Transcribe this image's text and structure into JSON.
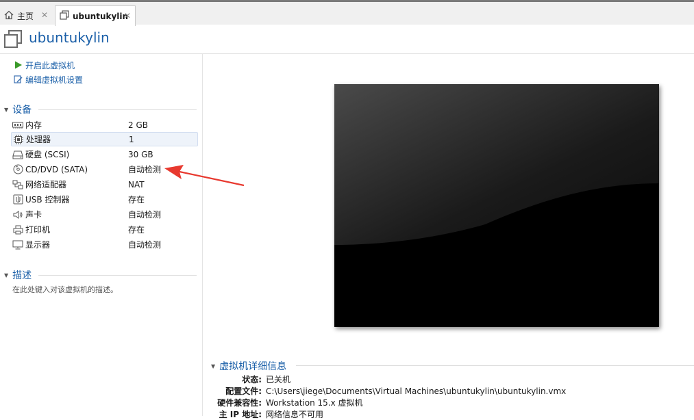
{
  "tabs": [
    {
      "label": "主页",
      "icon": "home-icon",
      "close": "✕"
    },
    {
      "label": "ubuntukylin",
      "icon": "vm-icon",
      "close": "✕"
    }
  ],
  "header": {
    "title": "ubuntukylin",
    "icon": "vm-icon"
  },
  "actions": [
    {
      "label": "开启此虚拟机",
      "icon": "play-icon"
    },
    {
      "label": "编辑虚拟机设置",
      "icon": "edit-settings-icon"
    }
  ],
  "devices": {
    "title": "设备",
    "items": [
      {
        "name": "内存",
        "value": "2 GB",
        "icon": "memory-icon"
      },
      {
        "name": "处理器",
        "value": "1",
        "icon": "cpu-icon"
      },
      {
        "name": "硬盘 (SCSI)",
        "value": "30 GB",
        "icon": "hard-disk-icon"
      },
      {
        "name": "CD/DVD (SATA)",
        "value": "自动检测",
        "icon": "cd-dvd-icon"
      },
      {
        "name": "网络适配器",
        "value": "NAT",
        "icon": "network-adapter-icon"
      },
      {
        "name": "USB 控制器",
        "value": "存在",
        "icon": "usb-icon"
      },
      {
        "name": "声卡",
        "value": "自动检测",
        "icon": "sound-card-icon"
      },
      {
        "name": "打印机",
        "value": "存在",
        "icon": "printer-icon"
      },
      {
        "name": "显示器",
        "value": "自动检测",
        "icon": "display-icon"
      }
    ]
  },
  "description": {
    "title": "描述",
    "placeholder": "在此处键入对该虚拟机的描述。"
  },
  "details": {
    "title": "虚拟机详细信息",
    "rows": [
      {
        "key": "状态:",
        "value": "已关机"
      },
      {
        "key": "配置文件:",
        "value": "C:\\Users\\jiege\\Documents\\Virtual Machines\\ubuntukylin\\ubuntukylin.vmx"
      },
      {
        "key": "硬件兼容性:",
        "value": "Workstation 15.x 虚拟机"
      },
      {
        "key": "主 IP 地址:",
        "value": "网络信息不可用"
      }
    ]
  },
  "colors": {
    "accent": "#1a5fa8",
    "arrow": "#e8392f",
    "play": "#3a9a2a"
  }
}
